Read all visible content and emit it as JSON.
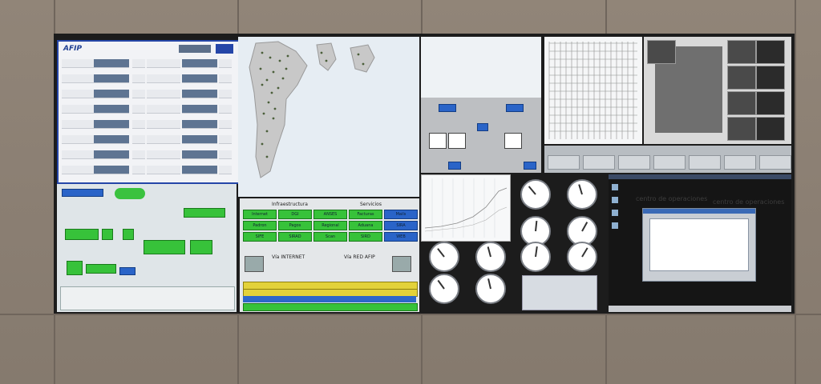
{
  "scene": {
    "description_tags": [
      "control-room",
      "video-wall",
      "monitoring-dashboard"
    ],
    "colors": {
      "wall": "#8d8277",
      "bezel": "#1c1c1c",
      "accent_green": "#37c23a",
      "accent_blue": "#2a64c8"
    }
  },
  "panels": {
    "afip_logo_text": "AFIP",
    "network_label": "Infraestructura",
    "services_label": "Servicios",
    "internet_label": "Vía INTERNET",
    "red_label": "Vía RED AFIP",
    "status_buttons": [
      "Internet",
      "DGI",
      "ANSES",
      "Facturas",
      "Mails",
      "Padron",
      "Pagos",
      "Regional",
      "Aduana",
      "SIRA",
      "SIFE",
      "SIRAD",
      "Scan",
      "SIRD",
      "WEB"
    ],
    "desktop_watermark": "centro de operaciones"
  }
}
